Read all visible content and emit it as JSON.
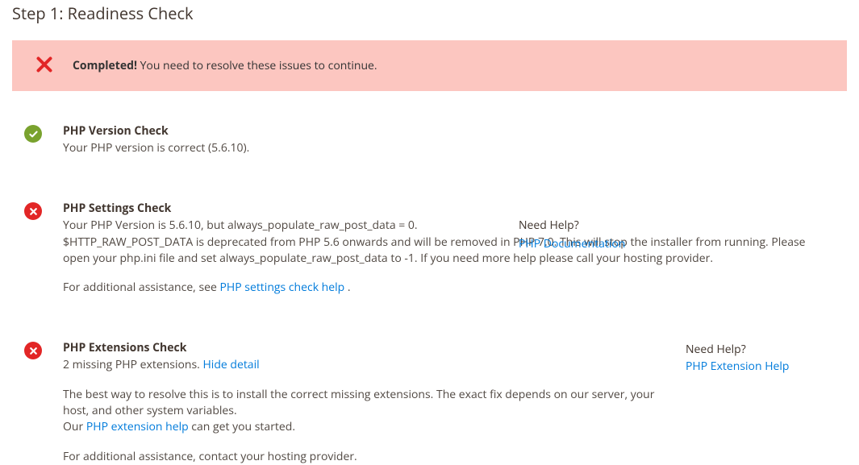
{
  "page": {
    "title": "Step 1: Readiness Check"
  },
  "alert": {
    "strong": "Completed!",
    "text": " You need to resolve these issues to continue."
  },
  "checks": {
    "php_version": {
      "title": "PHP Version Check",
      "body": "Your PHP version is correct (5.6.10)."
    },
    "php_settings": {
      "title": "PHP Settings Check",
      "body1": "Your PHP Version is 5.6.10, but always_populate_raw_post_data = 0.",
      "body2": " $HTTP_RAW_POST_DATA is deprecated from PHP 5.6 onwards and will be removed in PHP 7.0. This will stop the installer from running. Please open your php.ini file and set always_populate_raw_post_data to -1. If you need more help please call your hosting provider.",
      "assist_pre": "For additional assistance, see ",
      "assist_link": "PHP settings check help",
      "assist_post": " .",
      "help_label": "Need Help?",
      "help_link": "PHP Documentation"
    },
    "php_ext": {
      "title": "PHP Extensions Check",
      "summary": "2 missing PHP extensions. ",
      "toggle": "Hide detail",
      "detail1": "The best way to resolve this is to install the correct missing extensions. The exact fix depends on our server, your host, and other system variables.",
      "detail2_pre": "Our ",
      "detail2_link": "PHP extension help",
      "detail2_post": " can get you started.",
      "assist": "For additional assistance, contact your hosting provider.",
      "help_label": "Need Help?",
      "help_link": "PHP Extension Help"
    }
  }
}
